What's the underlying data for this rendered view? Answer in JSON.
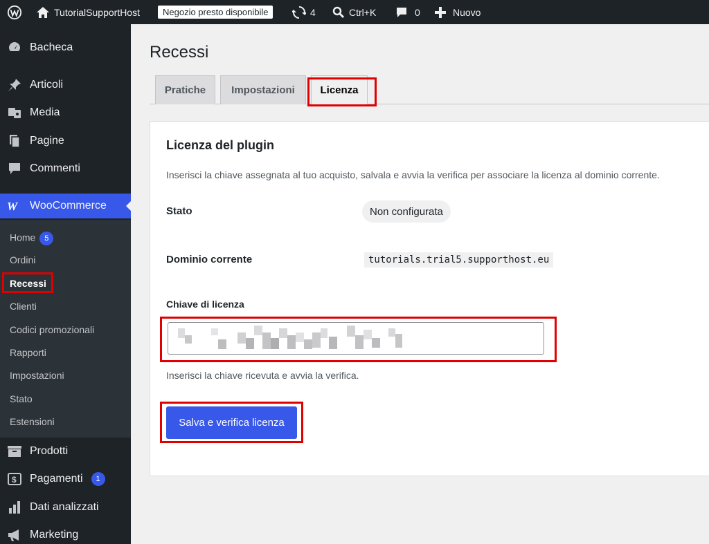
{
  "adminbar": {
    "site_name": "TutorialSupportHost",
    "notice": "Negozio presto disponibile",
    "updates_count": "4",
    "search_shortcut": "Ctrl+K",
    "comments_count": "0",
    "new_label": "Nuovo"
  },
  "sidebar": {
    "items": [
      {
        "label": "Bacheca",
        "icon": "dashboard-icon"
      },
      {
        "label": "Articoli",
        "icon": "pin-icon"
      },
      {
        "label": "Media",
        "icon": "media-icon"
      },
      {
        "label": "Pagine",
        "icon": "pages-icon"
      },
      {
        "label": "Commenti",
        "icon": "comments-icon"
      },
      {
        "label": "WooCommerce",
        "icon": "woocommerce-icon"
      },
      {
        "label": "Prodotti",
        "icon": "archive-icon"
      },
      {
        "label": "Pagamenti",
        "icon": "payments-icon",
        "badge": "1"
      },
      {
        "label": "Dati analizzati",
        "icon": "chart-bar-icon"
      },
      {
        "label": "Marketing",
        "icon": "megaphone-icon"
      }
    ],
    "submenu": [
      {
        "label": "Home",
        "badge": "5"
      },
      {
        "label": "Ordini"
      },
      {
        "label": "Recessi",
        "current": true
      },
      {
        "label": "Clienti"
      },
      {
        "label": "Codici promozionali"
      },
      {
        "label": "Rapporti"
      },
      {
        "label": "Impostazioni"
      },
      {
        "label": "Stato"
      },
      {
        "label": "Estensioni"
      }
    ]
  },
  "page": {
    "title": "Recessi",
    "tabs": [
      {
        "label": "Pratiche"
      },
      {
        "label": "Impostazioni"
      },
      {
        "label": "Licenza",
        "active": true
      }
    ]
  },
  "license": {
    "title": "Licenza del plugin",
    "description": "Inserisci la chiave assegnata al tuo acquisto, salvala e avvia la verifica per associare la licenza al dominio corrente.",
    "status_label": "Stato",
    "status_value": "Non configurata",
    "domain_label": "Dominio corrente",
    "domain_value": "tutorials.trial5.supporthost.eu",
    "key_label": "Chiave di licenza",
    "key_value": "",
    "help_text": "Inserisci la chiave ricevuta e avvia la verifica.",
    "submit_label": "Salva e verifica licenza"
  },
  "colors": {
    "accent": "#3858e9",
    "highlight": "#e00000",
    "sidebar_bg": "#1d2327"
  }
}
